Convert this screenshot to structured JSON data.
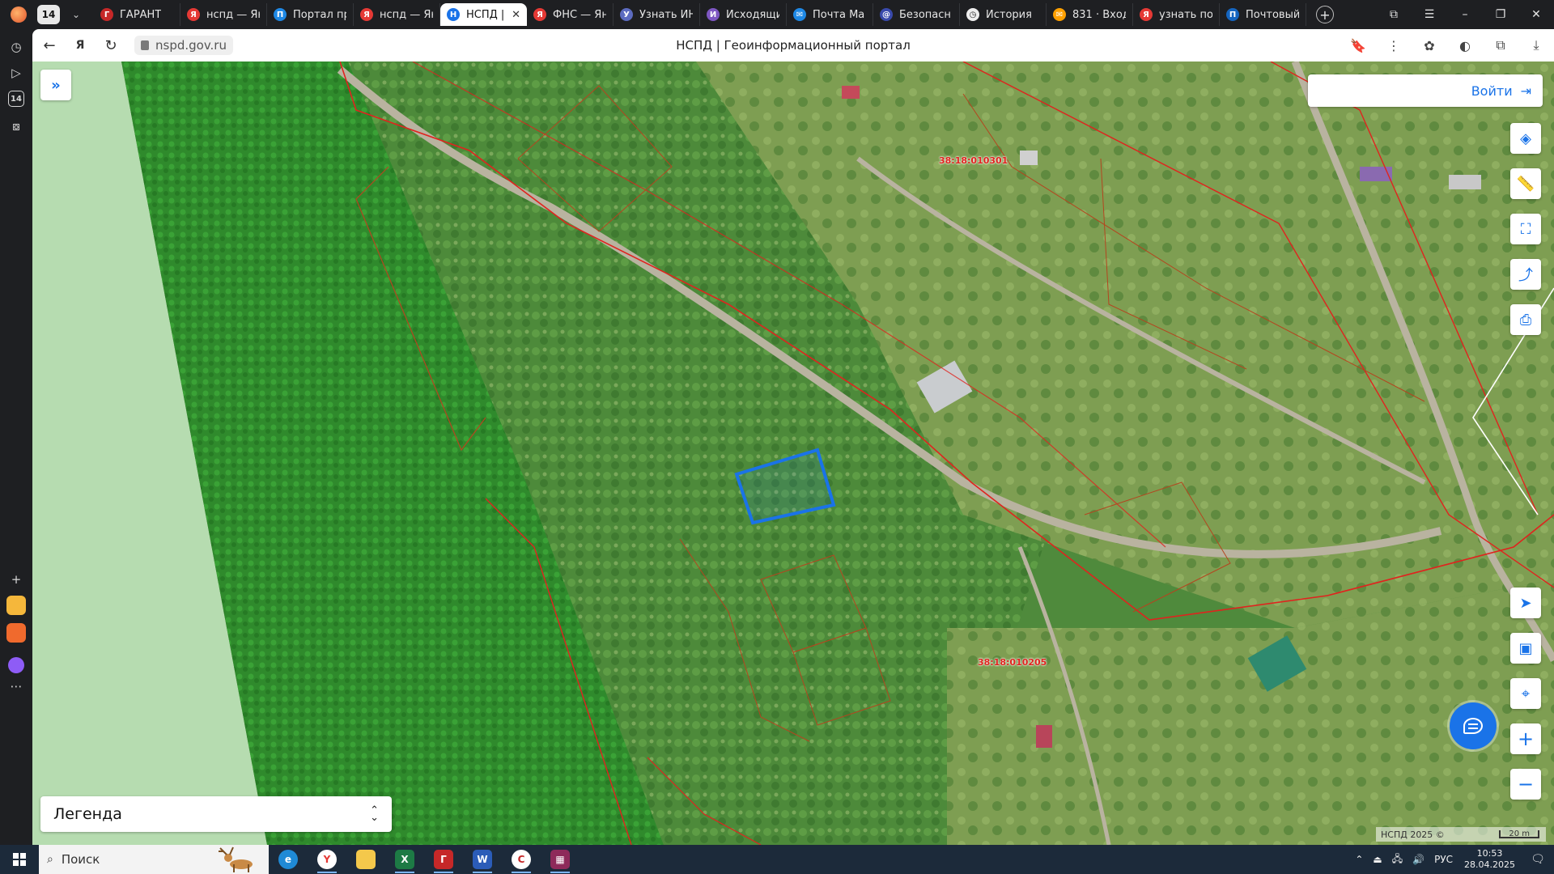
{
  "browser": {
    "tab_count": "14",
    "tabs": [
      {
        "label": "ГАРАНТ",
        "favicon": "garant-icon",
        "color": "#c62828",
        "glyph": "Г"
      },
      {
        "label": "нспд — Яндекс",
        "favicon": "yandex-icon",
        "color": "#e53935",
        "glyph": "Я"
      },
      {
        "label": "Портал пр",
        "favicon": "portal-icon",
        "color": "#1e88e5",
        "glyph": "П"
      },
      {
        "label": "нспд — Яндекс",
        "favicon": "yandex-icon",
        "color": "#e53935",
        "glyph": "Я"
      },
      {
        "label": "НСПД |",
        "favicon": "nspd-icon",
        "color": "#1a73e8",
        "glyph": "Н"
      },
      {
        "label": "ФНС — Яндекс",
        "favicon": "yandex-icon",
        "color": "#e53935",
        "glyph": "Я"
      },
      {
        "label": "Узнать ИН",
        "favicon": "gosuslugi-icon",
        "color": "#5c6bc0",
        "glyph": "У"
      },
      {
        "label": "Исходящи",
        "favicon": "mail-arrow-icon",
        "color": "#7e57c2",
        "glyph": "И"
      },
      {
        "label": "Почта Ма",
        "favicon": "mail-icon",
        "color": "#1e88e5",
        "glyph": "✉"
      },
      {
        "label": "Безопасн",
        "favicon": "security-icon",
        "color": "#3949ab",
        "glyph": "@"
      },
      {
        "label": "История",
        "favicon": "history-icon",
        "color": "#eeeeee",
        "glyph": "◷"
      },
      {
        "label": "831 · Вход",
        "favicon": "mail-yandex-icon",
        "color": "#ffa000",
        "glyph": "✉"
      },
      {
        "label": "узнать по",
        "favicon": "yandex-icon",
        "color": "#e53935",
        "glyph": "Я"
      },
      {
        "label": "Почтовый",
        "favicon": "post-icon",
        "color": "#1565c0",
        "glyph": "П"
      }
    ],
    "active_tab_index": 4,
    "url": "nspd.gov.ru",
    "page_title": "НСПД | Геоинформационный портал"
  },
  "sidebar_badge": "14",
  "map": {
    "login_label": "Войти",
    "legend_label": "Легенда",
    "parcel_labels": [
      "38:18:010301",
      "38:18:010205"
    ],
    "attribution": "НСПД 2025 ©",
    "scale_label": "20 m",
    "colors": {
      "accent": "#1a73e8",
      "parcel_border": "#e0231e",
      "selected_parcel": "#1a73e8"
    }
  },
  "taskbar": {
    "search_label": "Поиск",
    "language": "РУС",
    "time": "10:53",
    "date": "28.04.2025"
  }
}
